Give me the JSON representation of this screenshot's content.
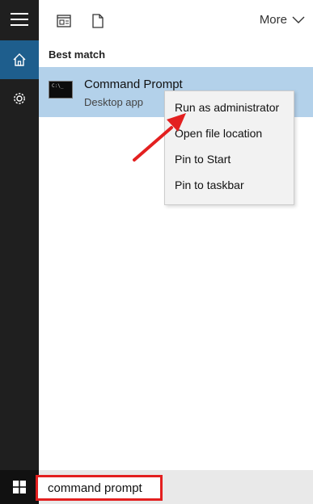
{
  "toolbar": {
    "more_label": "More",
    "icons": [
      "documents-icon",
      "file-icon",
      "chevron-down-icon"
    ]
  },
  "rail": {
    "icons": [
      "hamburger-icon",
      "home-icon",
      "settings-icon"
    ]
  },
  "results": {
    "section_label": "Best match",
    "best_match": {
      "name": "Command Prompt",
      "type": "Desktop app",
      "icon": "command-prompt-icon",
      "icon_text": "C:\\_"
    }
  },
  "context_menu": {
    "items": [
      "Run as administrator",
      "Open file location",
      "Pin to Start",
      "Pin to taskbar"
    ]
  },
  "taskbar": {
    "start_icon": "windows-logo-icon",
    "search_value": "command prompt"
  },
  "annotation": {
    "arrow_color": "#e32020",
    "highlight_color": "#e32020"
  },
  "colors": {
    "rail_bg": "#1f1f1f",
    "rail_active": "#1e5e8d",
    "selection_bg": "#b3d1ea",
    "menu_bg": "#f2f2f2"
  }
}
